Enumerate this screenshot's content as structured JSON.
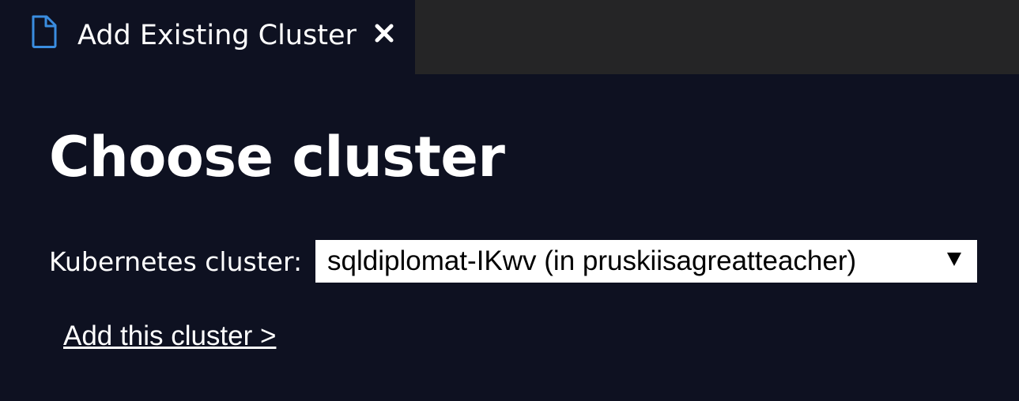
{
  "tab": {
    "icon": "file-icon",
    "label": "Add Existing Cluster",
    "close_icon": "close-icon"
  },
  "page": {
    "heading": "Choose cluster",
    "cluster_field": {
      "label": "Kubernetes cluster:",
      "selected_value": "sqldiplomat-IKwv (in pruskiisagreatteacher)",
      "arrow_icon": "dropdown-arrow-icon"
    },
    "add_link": "Add this cluster >"
  },
  "colors": {
    "background": "#0e1121",
    "tabbar_background": "#252526",
    "file_icon": "#3a8de0",
    "text": "#ffffff"
  }
}
